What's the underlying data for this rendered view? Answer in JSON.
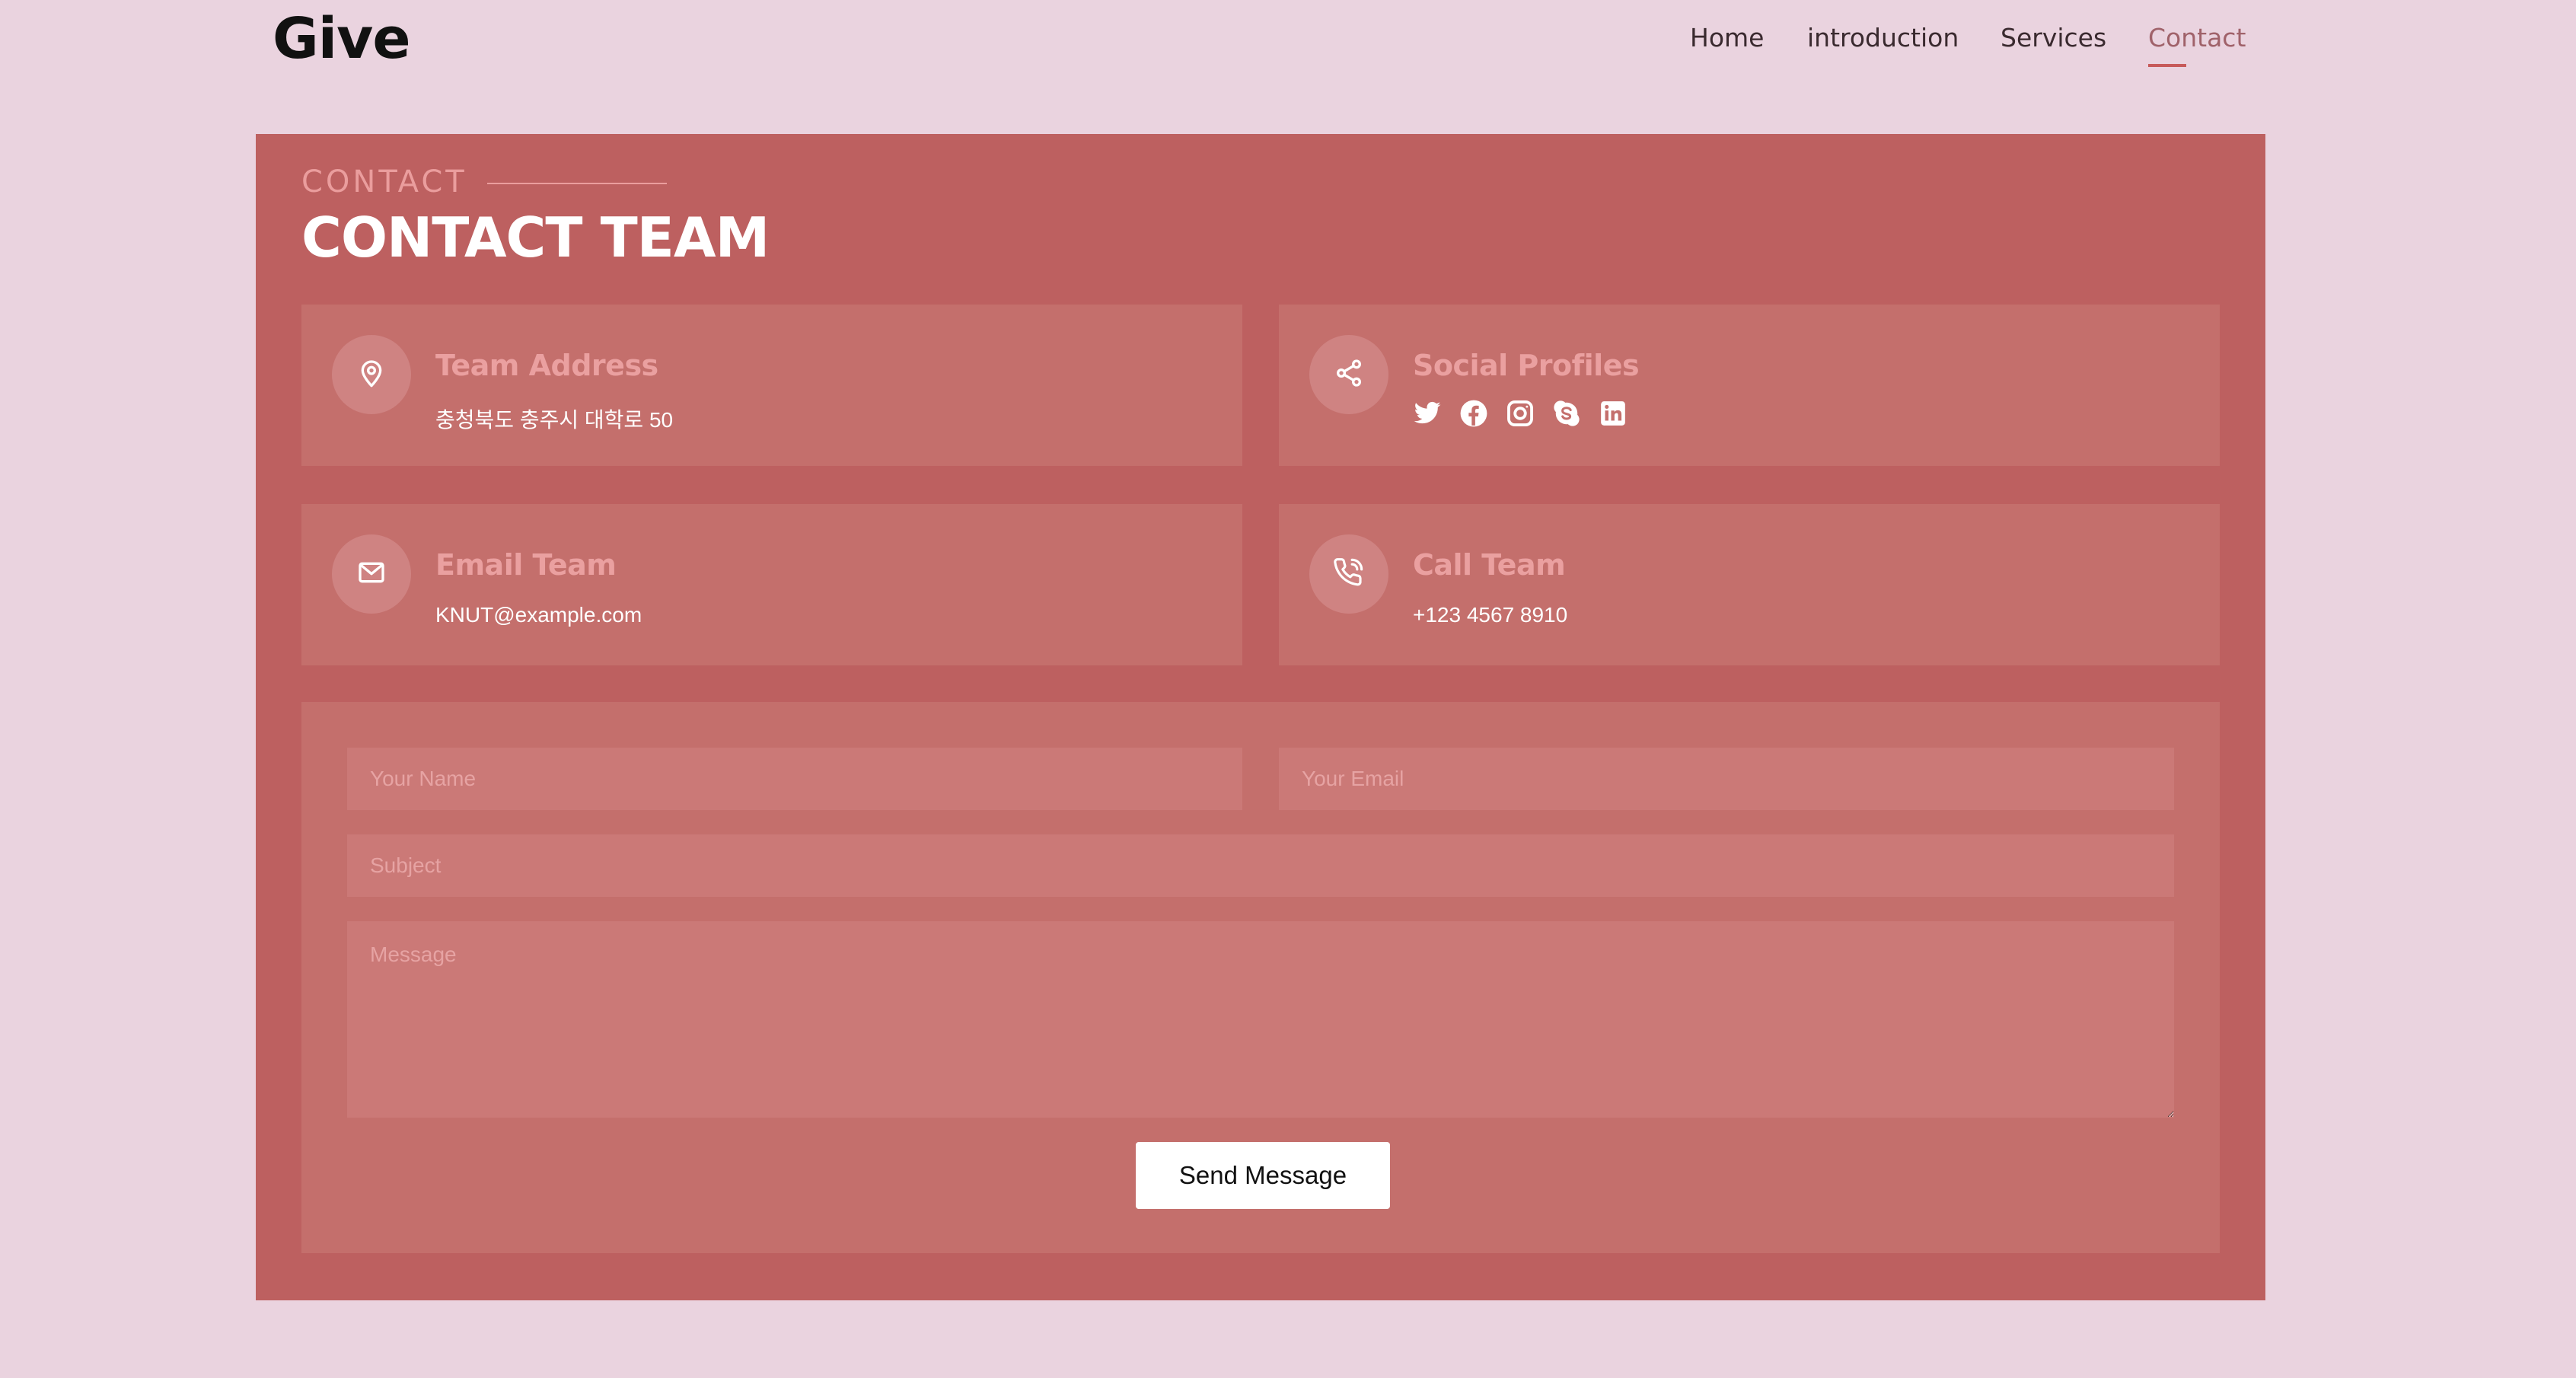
{
  "brand": {
    "logo": "Give"
  },
  "nav": {
    "items": [
      {
        "label": "Home"
      },
      {
        "label": "introduction"
      },
      {
        "label": "Services"
      },
      {
        "label": "Contact",
        "active": true
      }
    ]
  },
  "section": {
    "eyebrow": "CONTACT",
    "title": "CONTACT TEAM"
  },
  "cards": {
    "address": {
      "title": "Team Address",
      "text": "충청북도 충주시 대학로 50",
      "icon": "map-pin-icon"
    },
    "social": {
      "title": "Social Profiles",
      "icon": "share-icon",
      "profiles": [
        "twitter-icon",
        "facebook-icon",
        "instagram-icon",
        "skype-icon",
        "linkedin-icon"
      ]
    },
    "email": {
      "title": "Email Team",
      "text": "KNUT@example.com",
      "icon": "mail-icon"
    },
    "call": {
      "title": "Call Team",
      "text": "+123 4567 8910",
      "icon": "phone-icon"
    }
  },
  "form": {
    "name_placeholder": "Your Name",
    "email_placeholder": "Your Email",
    "subject_placeholder": "Subject",
    "message_placeholder": "Message",
    "send_label": "Send Message"
  },
  "colors": {
    "page_bg": "#ead3df",
    "panel_bg": "#bd6060",
    "card_bg": "#c46f6c",
    "accent": "#c75a5a"
  }
}
